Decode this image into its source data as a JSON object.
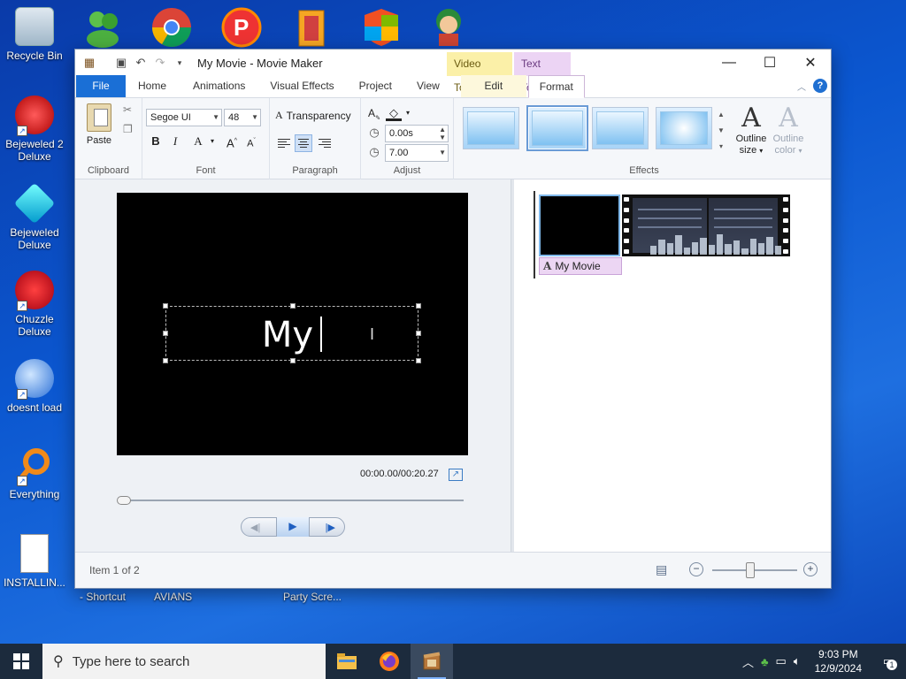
{
  "desktop": {
    "icons": [
      {
        "label": "Recycle Bin"
      },
      {
        "label": "Bejeweled 2 Deluxe"
      },
      {
        "label": "Bejeweled Deluxe"
      },
      {
        "label": "Chuzzle Deluxe"
      },
      {
        "label": "doesnt load"
      },
      {
        "label": "Everything"
      },
      {
        "label": "INSTALLIN..."
      }
    ],
    "partial_labels": [
      "- Shortcut",
      "AVIANS",
      "Party Scre..."
    ]
  },
  "window": {
    "title": "My Movie - Movie Maker",
    "context_tabs": {
      "video_tools": "Video Tools",
      "text_tools": "Text Tools"
    },
    "tabs": [
      "File",
      "Home",
      "Animations",
      "Visual Effects",
      "Project",
      "View",
      "Edit",
      "Format"
    ],
    "ribbon": {
      "clipboard": {
        "paste_label": "Paste",
        "group_label": "Clipboard"
      },
      "font": {
        "family": "Segoe UI",
        "size": "48",
        "group_label": "Font"
      },
      "paragraph": {
        "transparency_label": "Transparency",
        "group_label": "Paragraph"
      },
      "adjust": {
        "start_time": "0.00s",
        "duration": "7.00",
        "group_label": "Adjust"
      },
      "effects": {
        "group_label": "Effects",
        "outline_size": "Outline size",
        "outline_color": "Outline color"
      }
    },
    "preview": {
      "caption_text": "My",
      "timecode": "00:00.00/00:20.27"
    },
    "storyboard": {
      "title_clip_label": "My Movie"
    },
    "status": {
      "item_text": "Item 1 of 2",
      "zoom_level": 0.45
    }
  },
  "taskbar": {
    "search_placeholder": "Type here to search",
    "time": "9:03 PM",
    "date": "12/9/2024",
    "notification_count": "1"
  }
}
